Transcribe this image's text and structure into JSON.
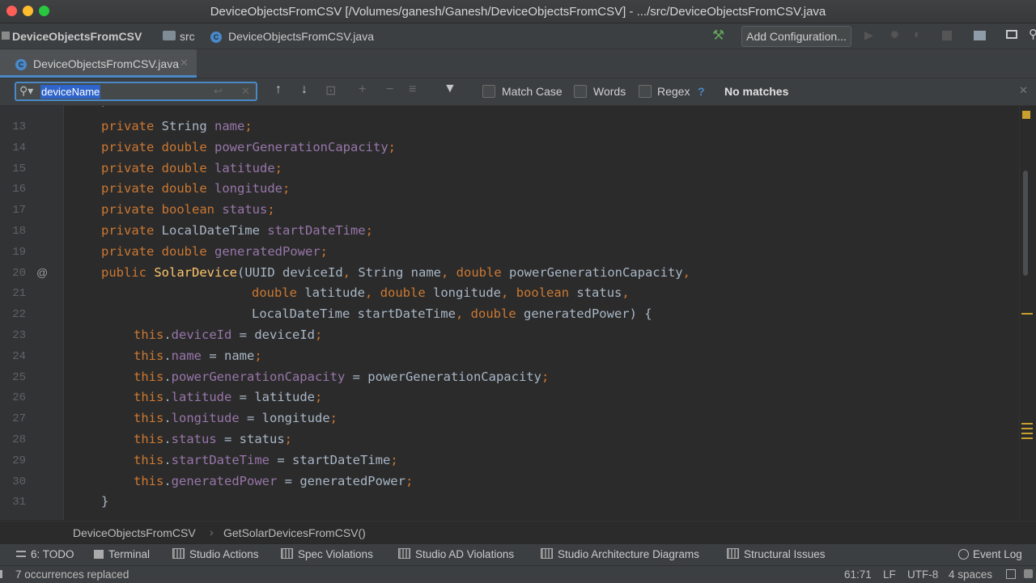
{
  "window": {
    "title": "DeviceObjectsFromCSV [/Volumes/ganesh/Ganesh/DeviceObjectsFromCSV] - .../src/DeviceObjectsFromCSV.java"
  },
  "navbar": {
    "project": "DeviceObjectsFromCSV",
    "folder": "src",
    "file": "DeviceObjectsFromCSV.java",
    "add_configuration": "Add Configuration..."
  },
  "tabs": [
    {
      "label": "DeviceObjectsFromCSV.java",
      "icon_letter": "C"
    }
  ],
  "find": {
    "query": "deviceName",
    "match_case": "Match Case",
    "words": "Words",
    "regex": "Regex",
    "help": "?",
    "result": "No matches"
  },
  "code": {
    "partial_line": "private UUID deviceId;",
    "lines": [
      {
        "n": "13",
        "text": "private String name;"
      },
      {
        "n": "14",
        "text": "private double powerGenerationCapacity;"
      },
      {
        "n": "15",
        "text": "private double latitude;"
      },
      {
        "n": "16",
        "text": "private double longitude;"
      },
      {
        "n": "17",
        "text": "private boolean status;"
      },
      {
        "n": "18",
        "text": "private LocalDateTime startDateTime;"
      },
      {
        "n": "19",
        "text": "private double generatedPower;"
      },
      {
        "n": "20",
        "text": "public SolarDevice(UUID deviceId, String name, double powerGenerationCapacity,",
        "gutter_mark": "@"
      },
      {
        "n": "21",
        "text": "double latitude, double longitude, boolean status,"
      },
      {
        "n": "22",
        "text": "LocalDateTime startDateTime, double generatedPower) {"
      },
      {
        "n": "23",
        "text": "this.deviceId = deviceId;"
      },
      {
        "n": "24",
        "text": "this.name = name;"
      },
      {
        "n": "25",
        "text": "this.powerGenerationCapacity = powerGenerationCapacity;"
      },
      {
        "n": "26",
        "text": "this.latitude = latitude;"
      },
      {
        "n": "27",
        "text": "this.longitude = longitude;"
      },
      {
        "n": "28",
        "text": "this.status = status;"
      },
      {
        "n": "29",
        "text": "this.startDateTime = startDateTime;"
      },
      {
        "n": "30",
        "text": "this.generatedPower = generatedPower;"
      },
      {
        "n": "31",
        "text": "}"
      }
    ]
  },
  "breadcrumb": {
    "class_name": "DeviceObjectsFromCSV",
    "method": "GetSolarDevicesFromCSV()"
  },
  "tool_windows": {
    "todo": "6: TODO",
    "terminal": "Terminal",
    "studio_actions": "Studio Actions",
    "spec_violations": "Spec Violations",
    "studio_ad_violations": "Studio AD Violations",
    "studio_architecture_diagrams": "Studio Architecture Diagrams",
    "structural_issues": "Structural Issues",
    "event_log": "Event Log"
  },
  "status": {
    "message": "7 occurrences replaced",
    "position": "61:71",
    "line_sep": "LF",
    "encoding": "UTF-8",
    "indent": "4 spaces"
  },
  "colors": {
    "accent": "#4a88c7",
    "keyword": "#cc7832",
    "field": "#9876aa",
    "method": "#ffc66d",
    "text": "#a9b7c6"
  }
}
